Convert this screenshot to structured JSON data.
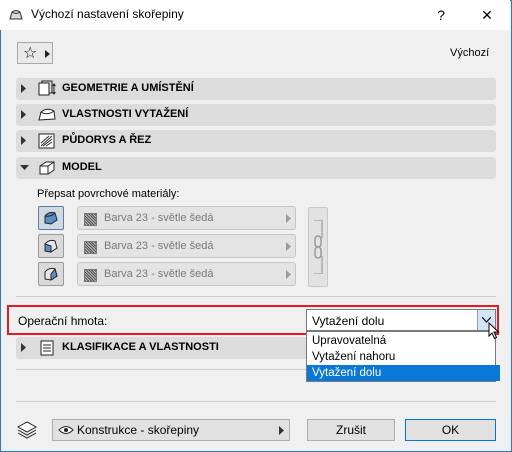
{
  "window": {
    "title": "Výchozí nastavení skořepiny",
    "help_glyph": "?",
    "close_glyph": "✕"
  },
  "favorites": {
    "star_glyph": "☆",
    "default_label": "Výchozí"
  },
  "panels": [
    {
      "label": "GEOMETRIE A UMÍSTĚNÍ",
      "expanded": false,
      "icon": "geometry-icon"
    },
    {
      "label": "VLASTNOSTI VYTAŽENÍ",
      "expanded": false,
      "icon": "extrusion-icon"
    },
    {
      "label": "PŮDORYS A ŘEZ",
      "expanded": false,
      "icon": "floorplan-section-icon"
    },
    {
      "label": "MODEL",
      "expanded": true,
      "icon": "model-icon"
    },
    {
      "label": "KLASIFIKACE A VLASTNOSTI",
      "expanded": false,
      "icon": "classification-icon"
    }
  ],
  "model": {
    "override_label": "Přepsat povrchové materiály:",
    "materials": [
      {
        "value": "Barva 23 - světle šedá",
        "icon": "surface-top-icon"
      },
      {
        "value": "Barva 23 - světle šedá",
        "icon": "surface-side-icon"
      },
      {
        "value": "Barva 23 - světle šedá",
        "icon": "surface-bottom-icon"
      }
    ]
  },
  "operation": {
    "label": "Operační hmota:",
    "selected": "Vytažení dolu",
    "options": [
      "Upravovatelná",
      "Vytažení nahoru",
      "Vytažení dolu"
    ],
    "selected_index": 2
  },
  "footer": {
    "layer_value": "Konstrukce - skořepiny",
    "cancel_label": "Zrušit",
    "ok_label": "OK"
  },
  "colors": {
    "highlight": "#e31b23",
    "selection": "#0a78d7",
    "window_border": "#2b79d0"
  }
}
